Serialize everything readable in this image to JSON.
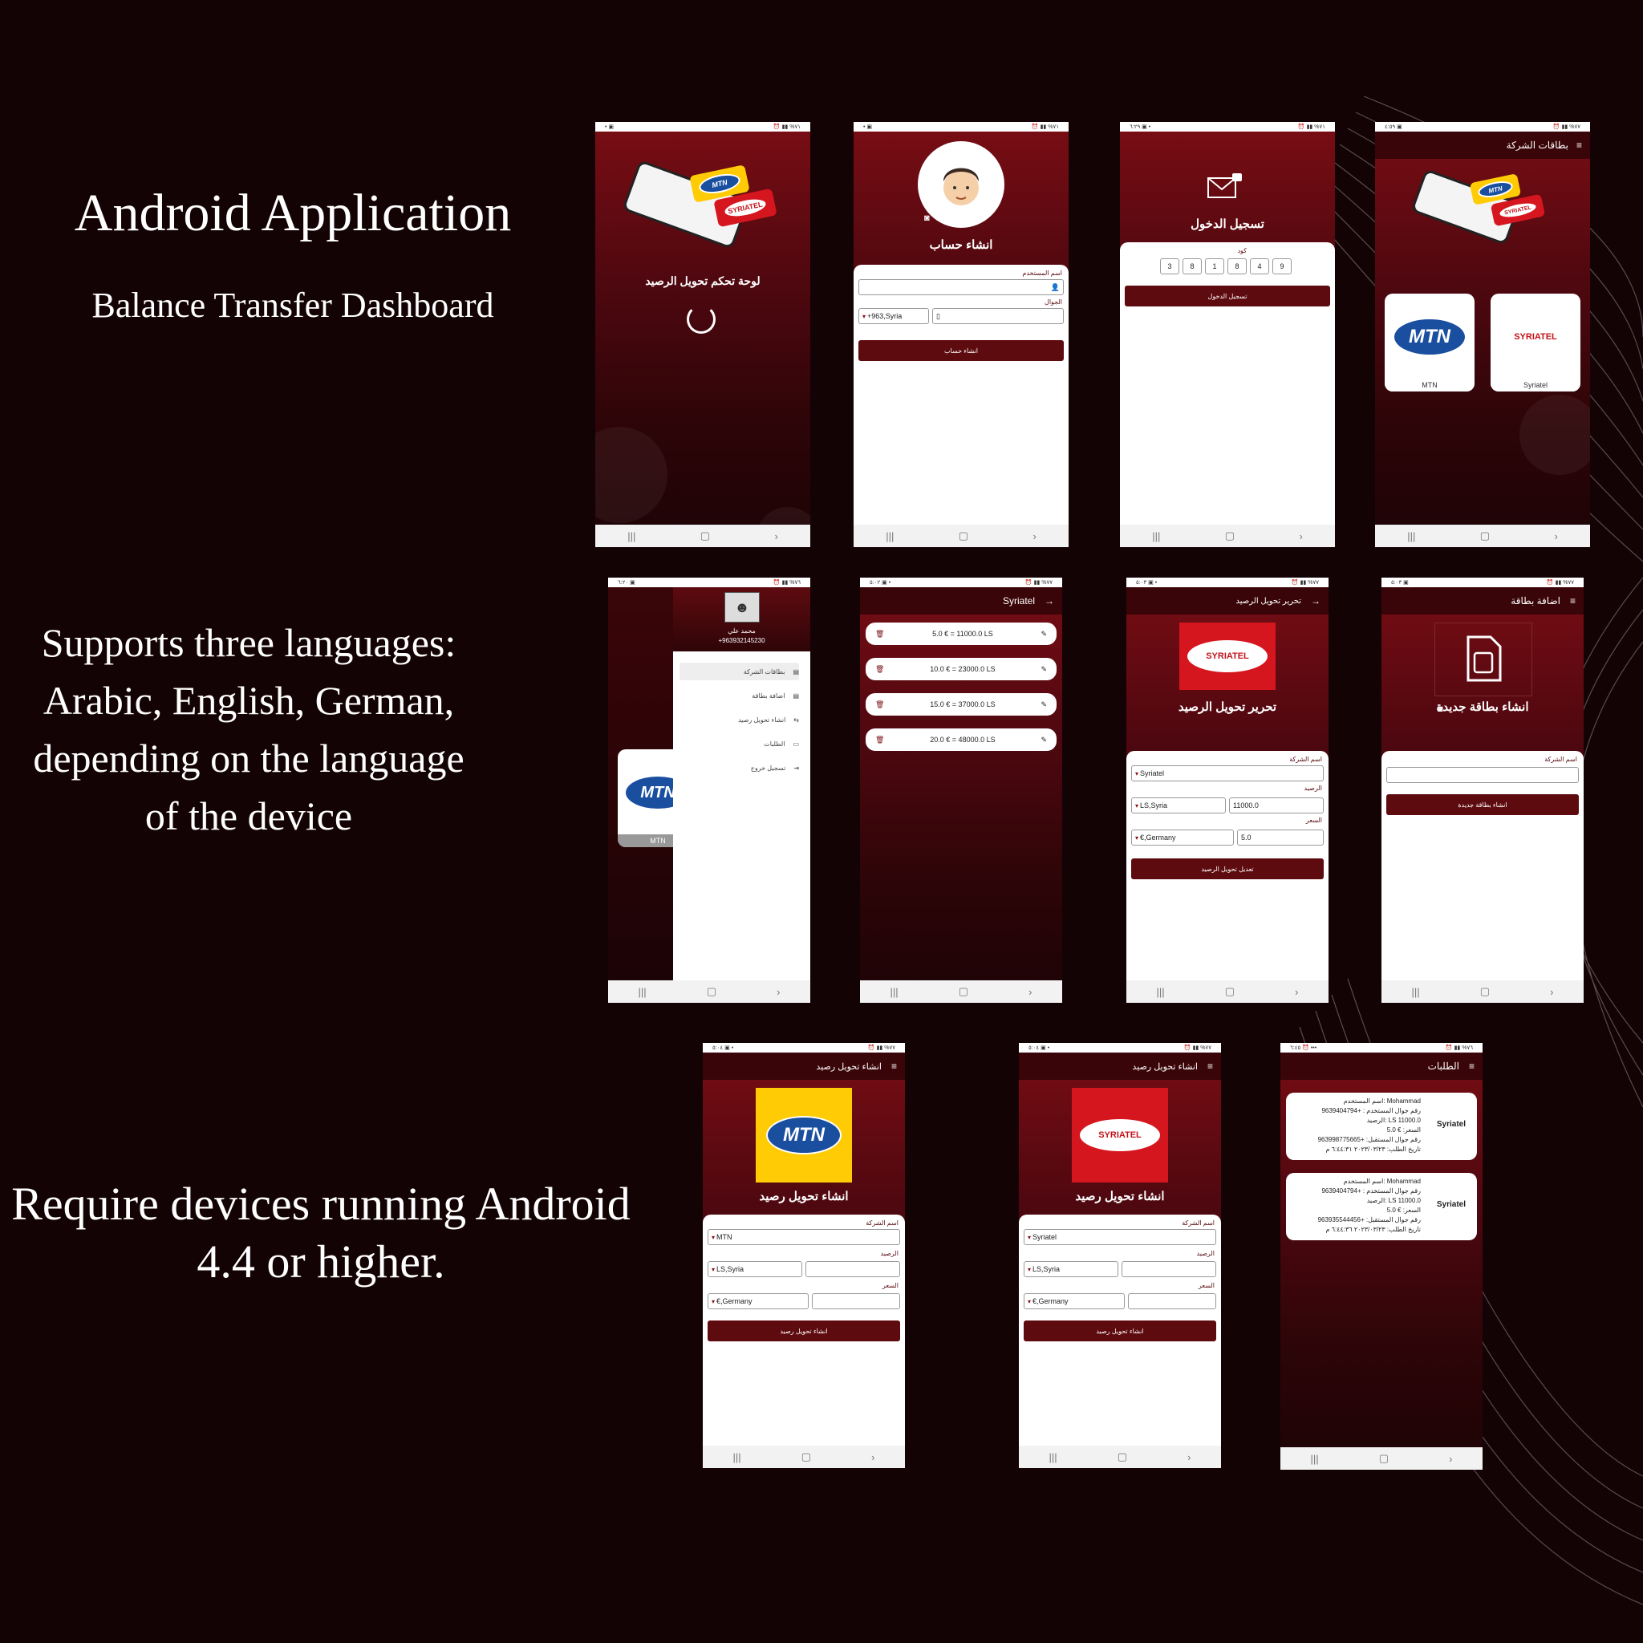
{
  "headings": {
    "title": "Android Application",
    "subtitle": "Balance Transfer Dashboard",
    "languages": "Supports three languages:\nArabic, English, German,\ndepending on the language\nof the device",
    "requirement": "Require devices running Android\n4.4 or higher."
  },
  "screens": {
    "splash": {
      "title": "لوحة تحكم تحويل الرصيد"
    },
    "register": {
      "title": "انشاء حساب",
      "username_label": "اسم المستخدم",
      "phone_label": "الجوال",
      "country_code": "+963,Syria",
      "button": "انشاء حساب"
    },
    "login": {
      "title": "تسجيل الدخول",
      "code_label": "كود",
      "code_digits": [
        "3",
        "8",
        "1",
        "8",
        "4",
        "9"
      ],
      "button": "تسجيل الدخول"
    },
    "company_cards": {
      "appbar_title": "بطاقات الشركة",
      "cards": [
        {
          "name": "MTN"
        },
        {
          "name": "Syriatel"
        }
      ]
    },
    "drawer": {
      "user_name": "محمد علي",
      "user_phone": "+963932145230",
      "bg_card_label": "MTN",
      "items": [
        "بطاقات الشركة",
        "اضافة بطاقة",
        "انشاء تحويل رصيد",
        "الطلبات",
        "تسجيل خروج"
      ]
    },
    "transfers": {
      "appbar_title": "Syriatel",
      "rows": [
        "5.0 € = 11000.0 LS",
        "10.0 € = 23000.0 LS",
        "15.0 € = 37000.0 LS",
        "20.0 € = 48000.0 LS"
      ]
    },
    "edit_transfer": {
      "appbar_title": "تحرير تحويل الرصيد",
      "title": "تحرير تحويل الرصيد",
      "company_label": "اسم الشركة",
      "company": "Syriatel",
      "balance_label": "الرصيد",
      "currency_from": "LS,Syria",
      "balance": "11000.0",
      "price_label": "السعر",
      "currency_to": "€,Germany",
      "price": "5.0",
      "button": "تعديل تحويل الرصيد"
    },
    "add_card": {
      "appbar_title": "اضافة بطاقة",
      "title": "انشاء بطاقة جديدة",
      "company_label": "اسم الشركة",
      "button": "انشاء بطاقة جديدة"
    },
    "create_mtn": {
      "appbar_title": "انشاء تحويل رصيد",
      "title": "انشاء تحويل رصيد",
      "company_label": "اسم الشركة",
      "company": "MTN",
      "balance_label": "الرصيد",
      "currency_from": "LS,Syria",
      "price_label": "السعر",
      "currency_to": "€,Germany",
      "button": "انشاء تحويل رصيد"
    },
    "create_syriatel": {
      "appbar_title": "انشاء تحويل رصيد",
      "title": "انشاء تحويل رصيد",
      "company_label": "اسم الشركة",
      "company": "Syriatel",
      "balance_label": "الرصيد",
      "currency_from": "LS,Syria",
      "price_label": "السعر",
      "currency_to": "€,Germany",
      "button": "انشاء تحويل رصيد"
    },
    "orders": {
      "appbar_title": "الطلبات",
      "orders": [
        {
          "company": "Syriatel",
          "lines": [
            "اسم المستخدم: Mohammad",
            "رقم جوال المستخدم : +9639404794",
            "الرصيد: LS 11000.0",
            "السعر: € 5.0",
            "رقم جوال المستقبل: +963998775665",
            "تاريخ الطلب: ٢٠٢٣/٠٣/٢٣ ٦:٤٤:٣١ م"
          ]
        },
        {
          "company": "Syriatel",
          "lines": [
            "اسم المستخدم: Mohammad",
            "رقم جوال المستخدم : +9639404794",
            "الرصيد: LS 11000.0",
            "السعر: € 5.0",
            "رقم جوال المستقبل: +963935544456",
            "تاريخ الطلب: ٢٠٢٣/٠٣/٢٣ ٦:٤٤:٣٦ م"
          ]
        }
      ]
    }
  },
  "logos": {
    "mtn_text": "MTN",
    "syriatel_text": "SYRIATEL"
  },
  "colors": {
    "background": "#140305",
    "primary": "#5e0b10",
    "accent_yellow": "#ffcb05",
    "accent_red": "#d6161f"
  },
  "icons": [
    "menu-icon",
    "arrow-back-icon",
    "camera-icon",
    "person-icon",
    "phone-icon",
    "mail-lock-icon",
    "trash-icon",
    "edit-icon",
    "sim-card-icon",
    "loading-spinner-icon"
  ]
}
